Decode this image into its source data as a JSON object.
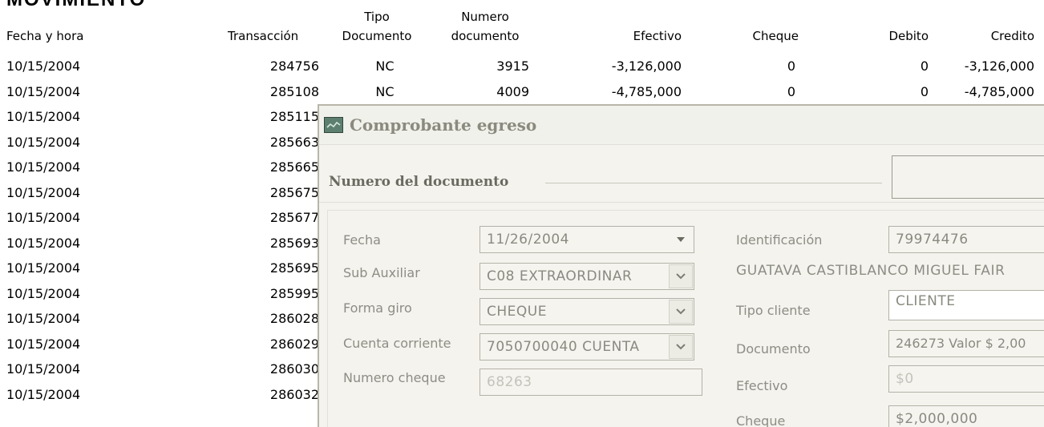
{
  "report": {
    "title": "MOVIMIENTO",
    "headers": {
      "fecha": "Fecha y hora",
      "transaccion": "Transacción",
      "tipo_doc_1": "Tipo",
      "tipo_doc_2": "Documento",
      "num_doc_1": "Numero",
      "num_doc_2": "documento",
      "efectivo": "Efectivo",
      "cheque": "Cheque",
      "debito": "Debito",
      "credito": "Credito"
    },
    "rows": [
      {
        "fecha": "10/15/2004",
        "transaccion": "284756",
        "tipo": "NC",
        "numero": "3915",
        "efectivo": "-3,126,000",
        "cheque": "0",
        "debito": "0",
        "credito": "-3,126,000"
      },
      {
        "fecha": "10/15/2004",
        "transaccion": "285108",
        "tipo": "NC",
        "numero": "4009",
        "efectivo": "-4,785,000",
        "cheque": "0",
        "debito": "0",
        "credito": "-4,785,000"
      },
      {
        "fecha": "10/15/2004",
        "transaccion": "285115"
      },
      {
        "fecha": "10/15/2004",
        "transaccion": "285663"
      },
      {
        "fecha": "10/15/2004",
        "transaccion": "285665"
      },
      {
        "fecha": "10/15/2004",
        "transaccion": "285675"
      },
      {
        "fecha": "10/15/2004",
        "transaccion": "285677"
      },
      {
        "fecha": "10/15/2004",
        "transaccion": "285693"
      },
      {
        "fecha": "10/15/2004",
        "transaccion": "285695"
      },
      {
        "fecha": "10/15/2004",
        "transaccion": "285995"
      },
      {
        "fecha": "10/15/2004",
        "transaccion": "286028"
      },
      {
        "fecha": "10/15/2004",
        "transaccion": "286029"
      },
      {
        "fecha": "10/15/2004",
        "transaccion": "286030"
      },
      {
        "fecha": "10/15/2004",
        "transaccion": "286032"
      }
    ]
  },
  "dialog": {
    "title": "Comprobante egreso",
    "group_title": "Numero del documento",
    "fecha": {
      "label": "Fecha",
      "value": "11/26/2004"
    },
    "sub_auxiliar": {
      "label": "Sub Auxiliar",
      "value": "C08  EXTRAORDINAR"
    },
    "forma_giro": {
      "label": "Forma giro",
      "value": "CHEQUE"
    },
    "cuenta_corriente": {
      "label": "Cuenta corriente",
      "value": "7050700040  CUENTA"
    },
    "numero_cheque": {
      "label": "Numero cheque",
      "value": "68263"
    },
    "identificacion": {
      "label": "Identificación",
      "value": "79974476"
    },
    "nombre": "GUATAVA CASTIBLANCO MIGUEL FAIR",
    "tipo_cliente": {
      "label": "Tipo cliente",
      "value": "CLIENTE"
    },
    "documento": {
      "label": "Documento",
      "value": "246273 Valor $ 2,00"
    },
    "efectivo": {
      "label": "Efectivo",
      "value": "$0"
    },
    "cheque": {
      "label": "Cheque",
      "value": "$2,000,000"
    }
  },
  "colors": {
    "dialog_bg": "#f4f3ee",
    "label_text": "#8d8d84",
    "field_border": "#b4b2a6"
  },
  "icons": {
    "window_icon": "app-window-icon",
    "dropdown": "chevron-down-icon"
  }
}
